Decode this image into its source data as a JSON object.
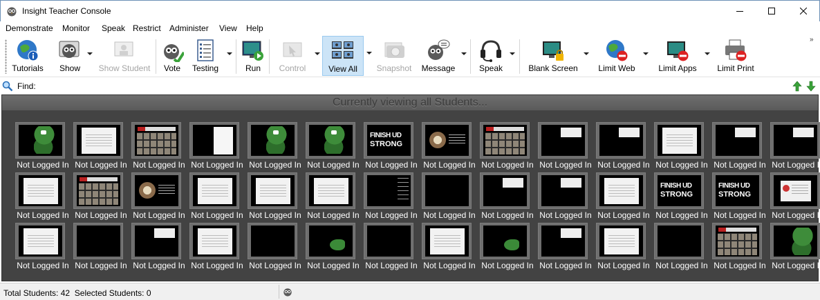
{
  "window": {
    "title": "Insight Teacher Console",
    "icon": "owl-icon"
  },
  "menu": [
    "Demonstrate",
    "Monitor",
    "Speak",
    "Restrict",
    "Administer",
    "View",
    "Help"
  ],
  "toolbar": {
    "buttons": [
      {
        "label": "Tutorials",
        "icon": "globe-info-icon",
        "enabled": true,
        "dropdown": false
      },
      {
        "label": "Show",
        "icon": "show-owl-icon",
        "enabled": true,
        "dropdown": true
      },
      {
        "label": "Show Student",
        "icon": "show-student-icon",
        "enabled": false,
        "dropdown": false
      },
      {
        "label": "Vote",
        "icon": "vote-owl-icon",
        "enabled": true,
        "dropdown": false
      },
      {
        "label": "Testing",
        "icon": "test-sheet-icon",
        "enabled": true,
        "dropdown": true
      },
      {
        "label": "Run",
        "icon": "run-monitor-icon",
        "enabled": true,
        "dropdown": false
      },
      {
        "label": "Control",
        "icon": "control-icon",
        "enabled": false,
        "dropdown": true
      },
      {
        "label": "View All",
        "icon": "view-all-icon",
        "enabled": true,
        "dropdown": true,
        "active": true
      },
      {
        "label": "Snapshot",
        "icon": "snapshot-camera-icon",
        "enabled": false,
        "dropdown": false
      },
      {
        "label": "Message",
        "icon": "message-owl-icon",
        "enabled": true,
        "dropdown": true
      },
      {
        "label": "Speak",
        "icon": "headset-icon",
        "enabled": true,
        "dropdown": true
      },
      {
        "label": "Blank Screen",
        "icon": "blank-screen-lock-icon",
        "enabled": true,
        "dropdown": true
      },
      {
        "label": "Limit Web",
        "icon": "limit-web-globe-icon",
        "enabled": true,
        "dropdown": true
      },
      {
        "label": "Limit Apps",
        "icon": "limit-apps-monitor-icon",
        "enabled": true,
        "dropdown": true
      },
      {
        "label": "Limit Print",
        "icon": "limit-print-printer-icon",
        "enabled": true,
        "dropdown": false
      }
    ],
    "overflow": "»"
  },
  "find": {
    "label": "Find:",
    "value": "",
    "icon": "magnifier-icon"
  },
  "viewer": {
    "banner": "Currently viewing all Students...",
    "tile_label": "Not Logged In",
    "rows": [
      [
        "gator",
        "doc",
        "grid",
        "xmas",
        "gator",
        "gator-blue",
        "finish",
        "circle",
        "grid",
        "building",
        "building",
        "doc",
        "building",
        "building"
      ],
      [
        "doc",
        "grid",
        "circle",
        "doc",
        "doc",
        "doc",
        "split",
        "city",
        "building",
        "building",
        "doc",
        "finish",
        "finish",
        "dark"
      ],
      [
        "doc",
        "black",
        "building",
        "doc",
        "city",
        "mixed",
        "black",
        "doc",
        "mixed",
        "building",
        "doc",
        "campus",
        "grid",
        "bluegator"
      ]
    ]
  },
  "status": {
    "total_label": "Total Students:",
    "total": "42",
    "selected_label": "Selected Students:",
    "selected": "0"
  }
}
